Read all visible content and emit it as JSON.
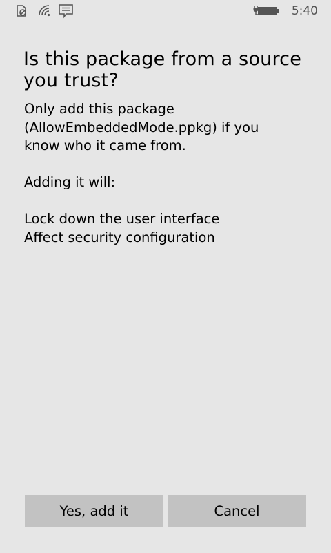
{
  "status_bar": {
    "icons": [
      "no-sim-icon",
      "wifi-icon",
      "notification-icon",
      "battery-charging-icon"
    ],
    "time": "5:40"
  },
  "dialog": {
    "title": "Is this package from a source you trust?",
    "body_lines": [
      "Only add this package",
      "(AllowEmbeddedMode.ppkg) if you",
      "know who it came from."
    ],
    "intro": "Adding it will:",
    "effects": [
      "Lock down the user interface",
      "Affect security configuration"
    ]
  },
  "buttons": {
    "confirm_label": "Yes, add it",
    "cancel_label": "Cancel"
  },
  "colors": {
    "background": "#e6e6e6",
    "button": "#c2c2c2",
    "status_icon": "#555555"
  }
}
